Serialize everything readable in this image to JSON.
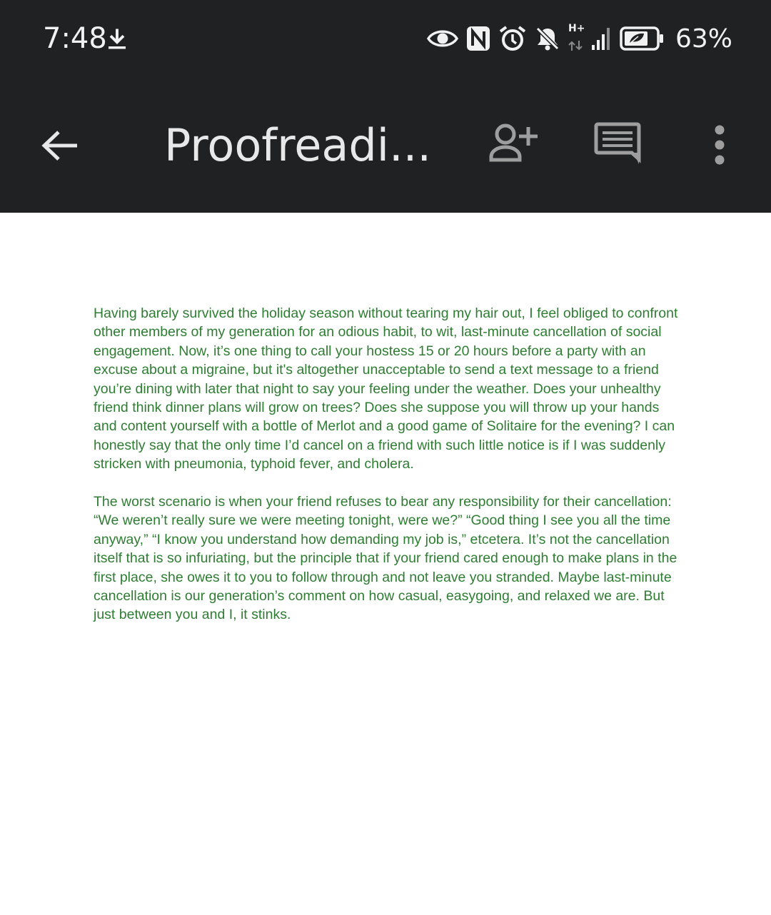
{
  "status_bar": {
    "time": "7:48",
    "battery_percent": "63%",
    "network_type": "H+",
    "icons": [
      "download-icon",
      "eye-icon",
      "nfc-icon",
      "alarm-icon",
      "notifications-off-icon",
      "signal-icon",
      "battery-saver-icon"
    ]
  },
  "toolbar": {
    "title": "Proofreadi...",
    "icons": [
      "back-arrow-icon",
      "add-person-icon",
      "comment-icon",
      "more-vertical-icon"
    ]
  },
  "document": {
    "paragraphs": [
      "Having barely survived the holiday season without tearing my hair out, I feel obliged to confront other members of my generation for an odious habit, to wit, last-minute cancellation of social engagement. Now, it’s one thing to call your hostess 15 or 20 hours before a party with an excuse about a migraine, but it's altogether unacceptable to send a text message to a friend you’re dining with later that night to say your feeling under the weather. Does your unhealthy friend think dinner plans will grow on trees? Does she suppose you will throw up your hands and content yourself with a bottle of Merlot and a good game of Solitaire for the evening? I can honestly say that the only time I’d cancel on a friend with such little notice is if I was suddenly stricken with pneumonia, typhoid fever, and cholera.",
      "The worst scenario is when your friend refuses to bear any responsibility for their cancellation: “We weren’t really sure we were meeting tonight, were we?” “Good thing I see you all the time anyway,” “I know you understand how demanding my job is,” etcetera. It’s not the cancellation itself that is so infuriating, but the principle that if your friend cared enough to make plans in the first place, she owes it to you to follow through and not leave you stranded. Maybe last-minute cancellation is our generation’s comment on how casual, easygoing, and relaxed we are. But just between you and I, it stinks."
    ],
    "text_color": "#2e7d32"
  },
  "colors": {
    "bar_background": "#1f2123",
    "icon_gray": "#9e9e9e",
    "page_background": "#ffffff"
  }
}
